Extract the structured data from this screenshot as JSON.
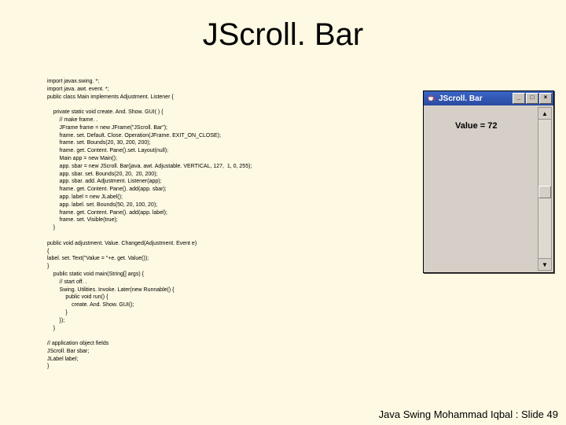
{
  "title": "JScroll. Bar",
  "code": "import javax.swing. *;\nimport java. awt. event. *;\npublic class Main implements Adjustment. Listener {\n\n    private static void create. And. Show. GUI( ) {\n        // make frame. .\n        JFrame frame = new JFrame(\"JScroll. Bar\");\n        frame. set. Default. Close. Operation(JFrame. EXIT_ON_CLOSE);\n        frame. set. Bounds(20, 30, 200, 200);\n        frame. get. Content. Pane().set. Layout(null);\n        Main app = new Main();\n        app. sbar = new JScroll. Bar(java. awt. Adjustable. VERTICAL, 127,  1, 0, 255);\n        app. sbar. set. Bounds(20, 20,  20, 200);\n        app. sbar. add. Adjustment. Listener(app);\n        frame. get. Content. Pane(). add(app. sbar);\n        app. label = new JLabel();\n        app. label. set. Bounds(50, 20, 100, 20);\n        frame. get. Content. Pane(). add(app. label);\n        frame. set. Visible(true);\n    }\n\npublic void adjustment. Value. Changed(Adjustment. Event e)\n{\nlabel. set. Text(\"Value = \"+e. get. Value());\n}\n    public static void main(String[] args) {\n        // start off. .\n        Swing. Utilities. Invoke. Later(new Runnable() {\n            public void run() {\n                create. And. Show. GUI();\n            }\n        });\n    }\n\n// application object fields\nJScroll. Bar sbar;\nJLabel label;\n}",
  "window": {
    "title": "JScroll. Bar",
    "value_label": "Value = 72",
    "min_btn": "_",
    "max_btn": "□",
    "close_btn": "×",
    "up_arrow": "▲",
    "down_arrow": "▼"
  },
  "footer": "Java Swing Mohammad Iqbal  :  Slide 49"
}
